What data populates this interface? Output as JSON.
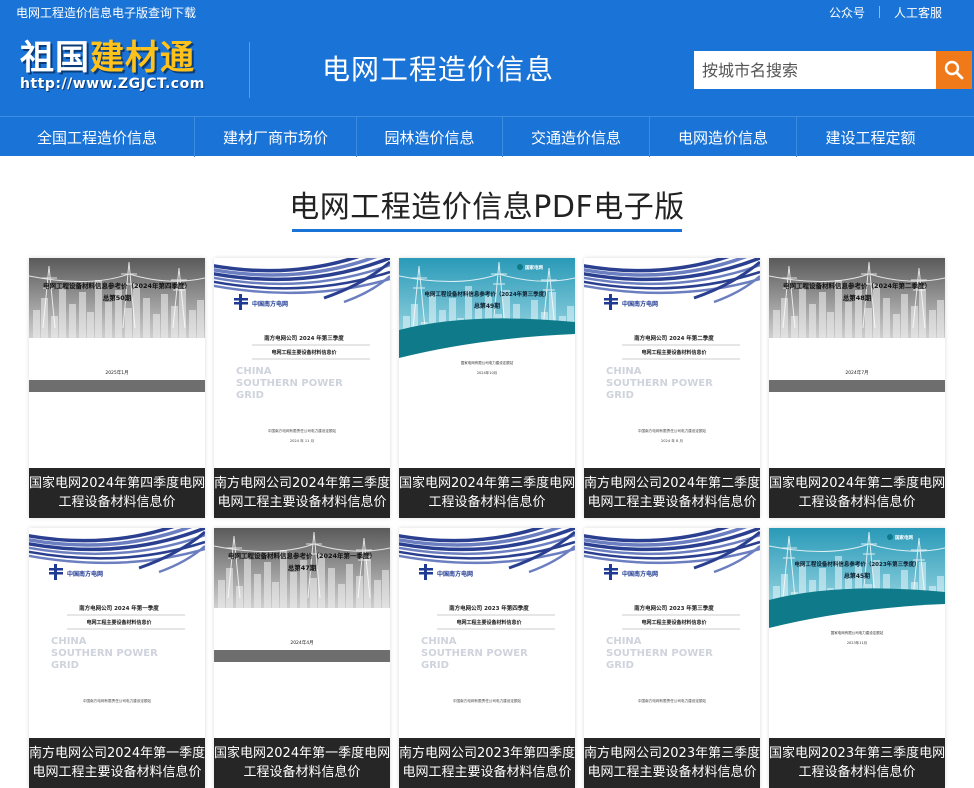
{
  "topbar": {
    "tagline": "电网工程造价信息电子版查询下载",
    "links": [
      "公众号",
      "人工客服"
    ]
  },
  "header": {
    "logo_main_white": "祖国",
    "logo_main_yellow": "建材通",
    "logo_url": "http://www.ZGJCT.com",
    "site_title": "电网工程造价信息",
    "search_placeholder": "按城市名搜索",
    "search_icon": "search-icon"
  },
  "nav": [
    "全国工程造价信息",
    "建材厂商市场价",
    "园林造价信息",
    "交通造价信息",
    "电网造价信息",
    "建设工程定额"
  ],
  "page_heading": "电网工程造价信息PDF电子版",
  "colors": {
    "brand_blue": "#1a73d6",
    "search_orange": "#f07a1a",
    "caption_bg": "#262626"
  },
  "cards": [
    {
      "line1": "国家电网2024年第四季度电网",
      "line2": "工程设备材料信息价",
      "cover": "gray",
      "cover_title": "电网工程设备材料信息参考价（2024年第四季度）",
      "cover_sub": "总第50期",
      "cover_date": "2025年1月"
    },
    {
      "line1": "南方电网公司2024年第三季度",
      "line2": "电网工程主要设备材料信息价",
      "cover": "csg",
      "cover_title": "南方电网公司 2024 年第三季度",
      "cover_sub": "电网工程主要设备材料信息价",
      "cover_org": "中国南方电网有限责任公司电力建设定额站",
      "cover_date": "2024 年 11 月",
      "cover_logo": "中国南方电网",
      "cover_en1": "CHINA",
      "cover_en2": "SOUTHERN POWER",
      "cover_en3": "GRID"
    },
    {
      "line1": "国家电网2024年第三季度电网",
      "line2": "工程设备材料信息价",
      "cover": "teal",
      "cover_title": "电网工程设备材料信息参考价（2024年第三季度）",
      "cover_sub": "总第49期",
      "cover_org": "国家电网有限公司电力建设定额站",
      "cover_date": "2024年10月",
      "cover_logo": "国家电网"
    },
    {
      "line1": "南方电网公司2024年第二季度",
      "line2": "电网工程主要设备材料信息价",
      "cover": "csg",
      "cover_title": "南方电网公司 2024 年第二季度",
      "cover_sub": "电网工程主要设备材料信息价",
      "cover_org": "中国南方电网有限责任公司电力建设定额站",
      "cover_date": "2024 年 8 月",
      "cover_logo": "中国南方电网",
      "cover_en1": "CHINA",
      "cover_en2": "SOUTHERN POWER",
      "cover_en3": "GRID"
    },
    {
      "line1": "国家电网2024年第二季度电网",
      "line2": "工程设备材料信息价",
      "cover": "gray",
      "cover_title": "电网工程设备材料信息参考价（2024年第二季度）",
      "cover_sub": "总第48期",
      "cover_date": "2024年7月"
    },
    {
      "line1": "南方电网公司2024年第一季度",
      "line2": "电网工程主要设备材料信息价",
      "cover": "csg",
      "cover_title": "南方电网公司 2024 年第一季度",
      "cover_sub": "电网工程主要设备材料信息价",
      "cover_org": "中国南方电网有限责任公司电力建设定额站",
      "cover_date": "",
      "cover_logo": "中国南方电网",
      "cover_en1": "CHINA",
      "cover_en2": "SOUTHERN POWER",
      "cover_en3": "GRID"
    },
    {
      "line1": "国家电网2024年第一季度电网",
      "line2": "工程设备材料信息价",
      "cover": "gray",
      "cover_title": "电网工程设备材料信息参考价（2024年第一季度）",
      "cover_sub": "总第47期",
      "cover_date": "2024年4月"
    },
    {
      "line1": "南方电网公司2023年第四季度",
      "line2": "电网工程主要设备材料信息价",
      "cover": "csg",
      "cover_title": "南方电网公司 2023 年第四季度",
      "cover_sub": "电网工程主要设备材料信息价",
      "cover_org": "中国南方电网有限责任公司电力建设定额站",
      "cover_date": "",
      "cover_logo": "中国南方电网",
      "cover_en1": "CHINA",
      "cover_en2": "SOUTHERN POWER",
      "cover_en3": "GRID"
    },
    {
      "line1": "南方电网公司2023年第三季度",
      "line2": "电网工程主要设备材料信息价",
      "cover": "csg",
      "cover_title": "南方电网公司 2023 年第三季度",
      "cover_sub": "电网工程主要设备材料信息价",
      "cover_org": "中国南方电网有限责任公司电力建设定额站",
      "cover_date": "",
      "cover_logo": "中国南方电网",
      "cover_en1": "CHINA",
      "cover_en2": "SOUTHERN POWER",
      "cover_en3": "GRID"
    },
    {
      "line1": "国家电网2023年第三季度电网",
      "line2": "工程设备材料信息价",
      "cover": "teal",
      "cover_title": "电网工程设备材料信息参考价（2023年第三季度）",
      "cover_sub": "总第45期",
      "cover_org": "国家电网有限公司电力建设定额站",
      "cover_date": "2023年11月",
      "cover_logo": "国家电网"
    }
  ]
}
